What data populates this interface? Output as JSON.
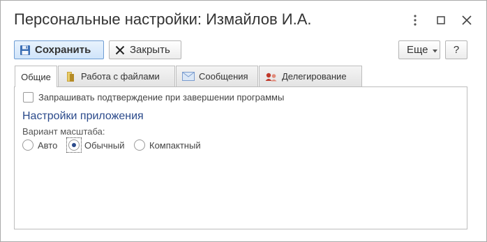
{
  "window": {
    "title": "Персональные настройки: Измайлов И.А.",
    "icons": [
      "more-vertical-icon",
      "maximize-icon",
      "close-icon"
    ]
  },
  "toolbar": {
    "save_label": "Сохранить",
    "close_label": "Закрыть",
    "more_label": "Еще",
    "help_label": "?"
  },
  "tabs": [
    {
      "label": "Общие",
      "active": true,
      "icon": ""
    },
    {
      "label": "Работа с файлами",
      "active": false,
      "icon": "folder-icon"
    },
    {
      "label": "Сообщения",
      "active": false,
      "icon": "envelope-icon"
    },
    {
      "label": "Делегирование",
      "active": false,
      "icon": "delegation-icon"
    }
  ],
  "general": {
    "confirm_exit_label": "Запрашивать подтверждение при завершении программы",
    "confirm_exit_checked": false,
    "section_title": "Настройки приложения",
    "scale_label": "Вариант масштаба:",
    "scale_options": [
      "Авто",
      "Обычный",
      "Компактный"
    ],
    "scale_selected": "Обычный"
  },
  "colors": {
    "accent": "#2b4a8b",
    "primary_button": "#cfe4fa",
    "border": "#bdbdbd"
  }
}
